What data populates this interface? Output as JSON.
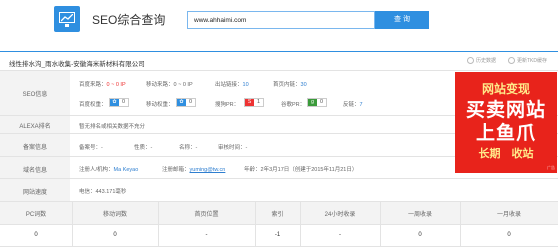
{
  "header": {
    "site_name": "SEO综合查询",
    "search_value": "www.ahhaimi.com",
    "search_button": "查 询"
  },
  "title": {
    "text": "线性排水沟_雨水收集-安徽海米新材料有限公司",
    "tools": [
      "历史数据",
      "更新TKD缓存"
    ]
  },
  "seo": {
    "label": "SEO信息",
    "line1": {
      "baidu_traffic_label": "百度来路：",
      "baidu_traffic_value": "0 ~ 0 IP",
      "mobile_traffic_label": "移动来路：",
      "mobile_traffic_value": "0 ~ 0 IP",
      "outlinks_label": "出站链接：",
      "outlinks_value": "10",
      "homelinks_label": "首页内链：",
      "homelinks_value": "30"
    },
    "line2": {
      "baidu_weight_label": "百度权重：",
      "baidu_weight_value": "0",
      "mobile_weight_label": "移动权重：",
      "mobile_weight_value": "0",
      "sogou_pr_label": "搜狗PR：",
      "sogou_pr_value": "1",
      "google_pr_label": "谷歌PR：",
      "google_pr_value": "0",
      "backlinks_label": "反链：",
      "backlinks_value": "7"
    }
  },
  "alexa": {
    "label": "ALEXA排名",
    "text": "暂无排名或相关数据不充分"
  },
  "icp": {
    "label": "备案信息",
    "icp_no_label": "备案号：",
    "icp_no_value": "-",
    "nature_label": "性质：",
    "nature_value": "-",
    "name_label": "名称：",
    "name_value": "-",
    "audit_label": "审核时间：",
    "audit_value": "-"
  },
  "whois": {
    "label": "域名信息",
    "registrant_label": "注册人/机构：",
    "registrant_value": "Ma Keyao",
    "email_label": "注册邮箱：",
    "email_value": "yuming@tw.cn",
    "age_label": "年龄：",
    "age_value": "2年3月17日（创建于2015年11月21日）"
  },
  "speed": {
    "label": "网站速度",
    "text": "电信：443.171毫秒"
  },
  "ad": {
    "line1": "网站变现",
    "line2": "买卖网站",
    "line3": "上鱼爪",
    "line4": "长期　收站",
    "tag": "广告"
  },
  "stats": {
    "headers": [
      "PC词数",
      "移动词数",
      "首页位置",
      "索引",
      "24小时收录",
      "一周收录",
      "一月收录"
    ],
    "values": [
      "0",
      "0",
      "-",
      "-1",
      "-",
      "0",
      "0"
    ]
  },
  "colors": {
    "accent": "#2f8fe0",
    "red": "#e33333",
    "ad_bg": "#e8231b"
  }
}
